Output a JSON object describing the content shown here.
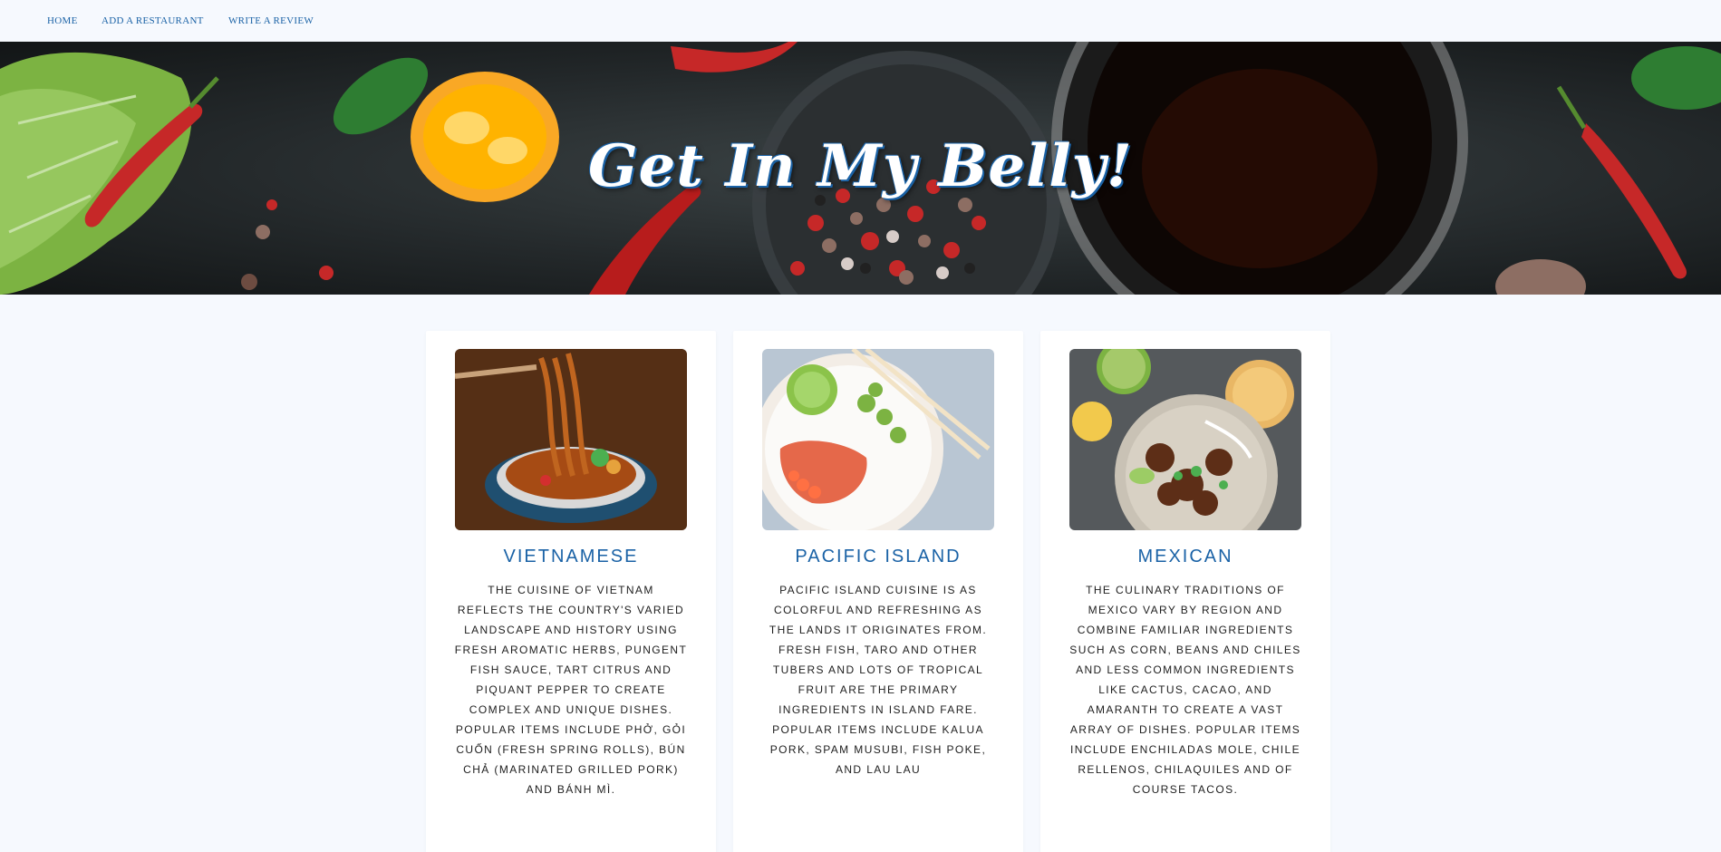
{
  "nav": {
    "home": "HOME",
    "add_restaurant": "ADD A RESTAURANT",
    "write_review": "WRITE A REVIEW"
  },
  "hero": {
    "title": "Get In My Belly!"
  },
  "cards": [
    {
      "title": "VIETNAMESE",
      "description": "THE CUISINE OF VIETNAM REFLECTS THE COUNTRY'S VARIED LANDSCAPE AND HISTORY USING FRESH AROMATIC HERBS, PUNGENT FISH SAUCE, TART CITRUS AND PIQUANT PEPPER TO CREATE COMPLEX AND UNIQUE DISHES. POPULAR ITEMS INCLUDE PHỞ, GỎI CUỐN (FRESH SPRING ROLLS), BÚN CHẢ (MARINATED GRILLED PORK) AND BÁNH MÌ."
    },
    {
      "title": "PACIFIC ISLAND",
      "description": "PACIFIC ISLAND CUISINE IS AS COLORFUL AND REFRESHING AS THE LANDS IT ORIGINATES FROM. FRESH FISH, TARO AND OTHER TUBERS AND LOTS OF TROPICAL FRUIT ARE THE PRIMARY INGREDIENTS IN ISLAND FARE. POPULAR ITEMS INCLUDE KALUA PORK, SPAM MUSUBI, FISH POKE, AND LAU LAU"
    },
    {
      "title": "MEXICAN",
      "description": "THE CULINARY TRADITIONS OF MEXICO VARY BY REGION AND COMBINE FAMILIAR INGREDIENTS SUCH AS CORN, BEANS AND CHILES AND LESS COMMON INGREDIENTS LIKE CACTUS, CACAO, AND AMARANTH TO CREATE A VAST ARRAY OF DISHES. POPULAR ITEMS INCLUDE ENCHILADAS MOLE, CHILE RELLENOS, CHILAQUILES AND OF COURSE TACOS."
    }
  ],
  "colors": {
    "accent": "#1a62a6",
    "page_bg": "#f6f9fe",
    "card_bg": "#ffffff"
  }
}
